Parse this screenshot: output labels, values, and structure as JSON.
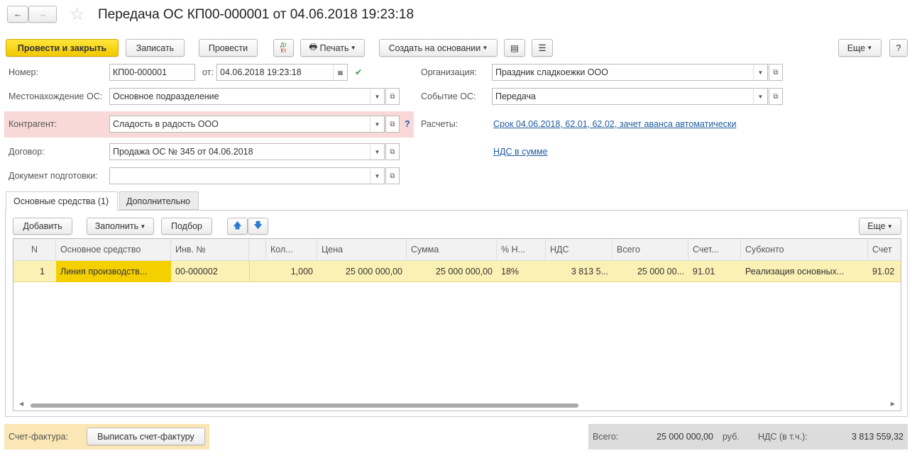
{
  "title": "Передача ОС КП00-000001 от 04.06.2018 19:23:18",
  "toolbar": {
    "post_close": "Провести и закрыть",
    "save": "Записать",
    "post": "Провести",
    "print": "Печать",
    "create_based": "Создать на основании",
    "more": "Еще",
    "help": "?"
  },
  "form": {
    "number_label": "Номер:",
    "number": "КП00-000001",
    "date_label": "от:",
    "date": "04.06.2018 19:23:18",
    "location_label": "Местонахождение ОС:",
    "location": "Основное подразделение",
    "counterparty_label": "Контрагент:",
    "counterparty": "Сладость в радость ООО",
    "contract_label": "Договор:",
    "contract": "Продажа ОС № 345 от 04.06.2018",
    "prep_doc_label": "Документ подготовки:",
    "prep_doc": "",
    "org_label": "Организация:",
    "org": "Праздник сладкоежки ООО",
    "event_label": "Событие ОС:",
    "event": "Передача",
    "settlements_label": "Расчеты:",
    "settlements": "Срок 04.06.2018, 62.01, 62.02, зачет аванса автоматически",
    "vat_link": "НДС в сумме",
    "help_q": "?"
  },
  "tabs": [
    "Основные средства (1)",
    "Дополнительно"
  ],
  "table_toolbar": {
    "add": "Добавить",
    "fill": "Заполнить",
    "select": "Подбор",
    "more": "Еще"
  },
  "table": {
    "columns": [
      "N",
      "Основное средство",
      "Инв. №",
      "",
      "Кол...",
      "Цена",
      "Сумма",
      "% Н...",
      "НДС",
      "Всего",
      "Счет...",
      "Субконто",
      "Счет"
    ],
    "rows": [
      [
        "1",
        "Линия производств...",
        "00-000002",
        "",
        "1,000",
        "25 000 000,00",
        "25 000 000,00",
        "18%",
        "3 813 5...",
        "25 000 00...",
        "91.01",
        "Реализация основных...",
        "91.02"
      ]
    ]
  },
  "footer": {
    "invoice_label": "Счет-фактура:",
    "invoice_button": "Выписать счет-фактуру",
    "total_label": "Всего:",
    "total": "25 000 000,00",
    "currency": "руб.",
    "vat_label": "НДС (в т.ч.):",
    "vat": "3 813 559,32"
  }
}
